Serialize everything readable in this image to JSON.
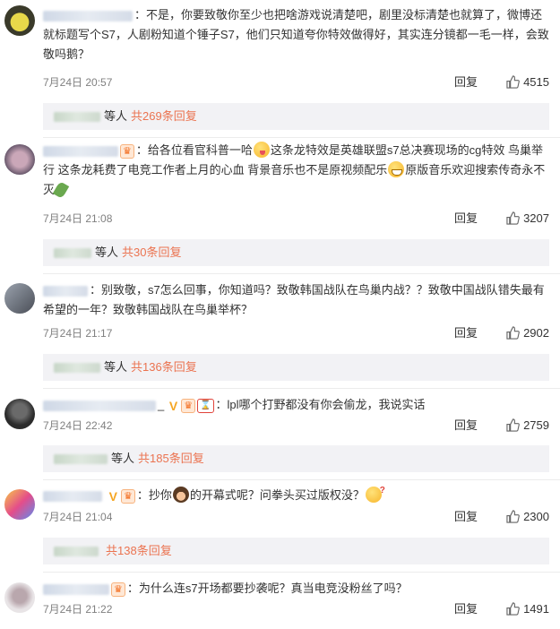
{
  "comments": [
    {
      "avatar_colors": [
        "#3a3a2a",
        "#e8d84a"
      ],
      "text": "不是，你要致敬你至少也把啥游戏说清楚吧，剧里没标清楚也就算了，微博还就标题写个S7，人剧粉知道个锤子S7，他们只知道夸你特效做得好，其实连分镜都一毛一样，会致敬吗鹅？",
      "time": "7月24日 20:57",
      "reply": "回复",
      "likes": "4515",
      "sub_deng": "等人",
      "sub_count": "共269条回复"
    },
    {
      "avatar_colors": [
        "#6b5a6e",
        "#caa7b8"
      ],
      "text_a": "给各位看官科普一哈",
      "text_b": "这条龙特效是英雄联盟s7总决赛现场的cg特效 鸟巢举行 这条龙耗费了电竞工作者上月的心血 背景音乐也不是原视频配乐",
      "text_c": "原版音乐欢迎搜索传奇永不灭",
      "time": "7月24日 21:08",
      "reply": "回复",
      "likes": "3207",
      "sub_deng": "等人",
      "sub_count": "共30条回复"
    },
    {
      "avatar_colors": [
        "#4a4e57",
        "#9aa2ad"
      ],
      "text": "别致敬，s7怎么回事，你知道吗？致敬韩国战队在鸟巢内战？？致敬中国战队错失最有希望的一年？致敬韩国战队在鸟巢举杯？",
      "time": "7月24日 21:17",
      "reply": "回复",
      "likes": "2902",
      "sub_deng": "等人",
      "sub_count": "共136条回复"
    },
    {
      "avatar_colors": [
        "#2b2b2b",
        "#6a6a6a"
      ],
      "name_suffix": "_",
      "text": "lpl哪个打野都没有你会偷龙，我说实话",
      "time": "7月24日 22:42",
      "reply": "回复",
      "likes": "2759",
      "sub_deng": "等人",
      "sub_count": "共185条回复"
    },
    {
      "avatar_colors": [
        "#e44d8a",
        "#f7c948"
      ],
      "text_a": "抄你",
      "text_b": "的开幕式呢？问拳头买过版权没？",
      "time": "7月24日 21:04",
      "reply": "回复",
      "likes": "2300",
      "sub_deng": "",
      "sub_count": "共138条回复"
    },
    {
      "avatar_colors": [
        "#e8e4e6",
        "#b9a7ad"
      ],
      "text": "为什么连s7开场都要抄袭呢？真当电竞没粉丝了吗？",
      "time": "7月24日 21:22",
      "reply": "回复",
      "likes": "1491"
    }
  ],
  "icons": {
    "like": "thumbs-up-icon",
    "verified": "v-badge-icon",
    "vip": "vip-crown-icon"
  },
  "colors": {
    "link": "#eb7350",
    "sub_bg": "#f2f2f5",
    "text": "#333333",
    "meta": "#808080"
  }
}
